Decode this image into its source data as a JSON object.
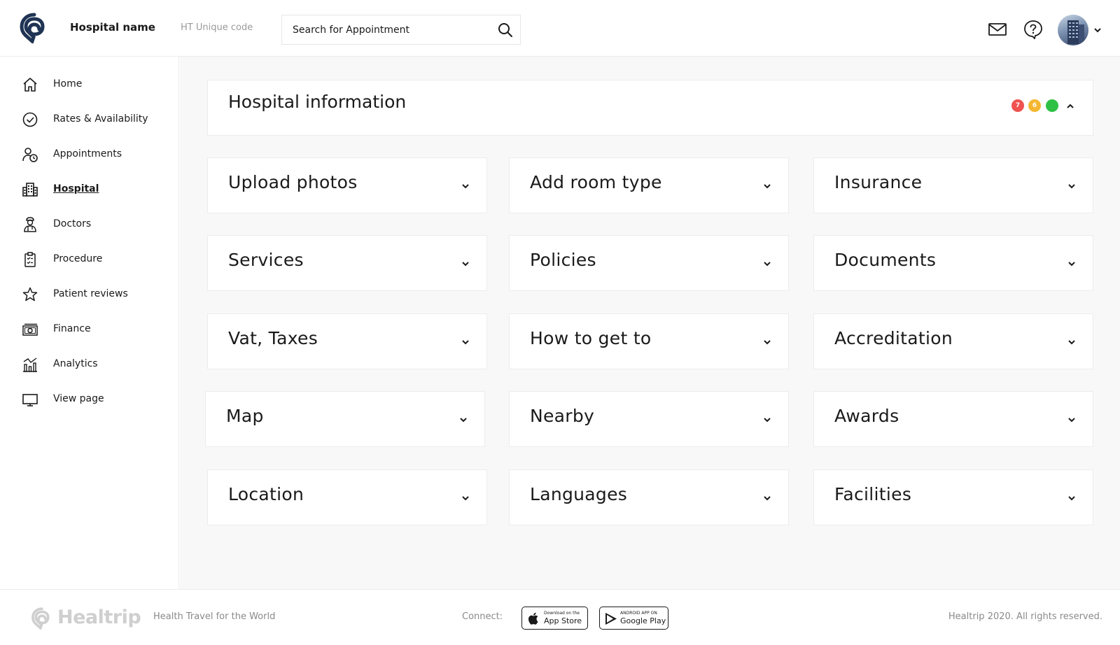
{
  "header": {
    "hospital_name": "Hospital name",
    "unique_code": "HT Unique code",
    "search_placeholder": "Search for Appointment"
  },
  "sidebar": {
    "items": [
      {
        "label": "Home",
        "icon": "home-icon"
      },
      {
        "label": "Rates & Availability",
        "icon": "check-circle-icon"
      },
      {
        "label": "Appointments",
        "icon": "user-clock-icon"
      },
      {
        "label": "Hospital",
        "icon": "building-icon",
        "active": true
      },
      {
        "label": "Doctors",
        "icon": "doctor-icon"
      },
      {
        "label": "Procedure",
        "icon": "clipboard-icon"
      },
      {
        "label": "Patient reviews",
        "icon": "star-icon"
      },
      {
        "label": "Finance",
        "icon": "money-icon"
      },
      {
        "label": "Analytics",
        "icon": "bar-chart-icon"
      },
      {
        "label": "View page",
        "icon": "monitor-icon"
      }
    ]
  },
  "info_card": {
    "title": "Hospital information",
    "badges": [
      {
        "count": "7",
        "color": "#f0524f"
      },
      {
        "count": "6",
        "color": "#f5b731"
      },
      {
        "count": "",
        "color": "#2fc145"
      }
    ]
  },
  "sections": {
    "c1": [
      "Upload photos",
      "Services",
      "Vat, Taxes",
      "Map",
      "Location"
    ],
    "c2": [
      "Add room type",
      "Policies",
      "How to get to",
      "Nearby",
      "Languages"
    ],
    "c3": [
      "Insurance",
      "Documents",
      "Accreditation",
      "Awards",
      "Facilities"
    ]
  },
  "footer": {
    "brand": "Healtrip",
    "tagline": "Health Travel for the World",
    "connect": "Connect:",
    "app_store_small": "Download on the",
    "app_store": "App Store",
    "google_play_small": "ANDROID APP ON",
    "google_play": "Google Play",
    "copyright": "Healtrip 2020. All rights reserved."
  }
}
